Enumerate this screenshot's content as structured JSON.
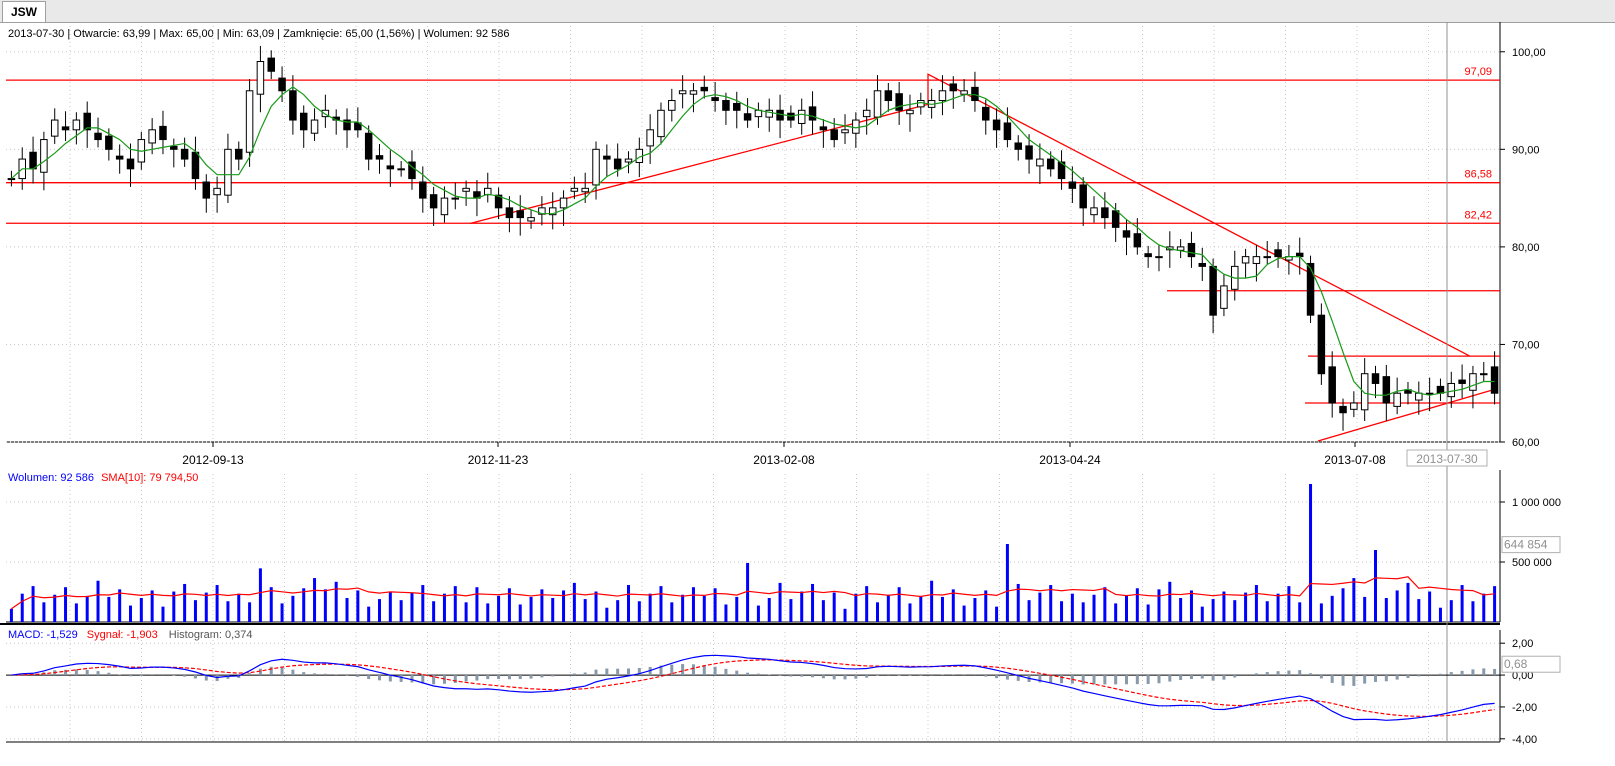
{
  "tab": {
    "label": "JSW"
  },
  "info_bar": {
    "date": "2013-07-30",
    "open": "Otwarcie: 63,99",
    "max": "Max: 65,00",
    "min": "Min: 63,09",
    "close": "Zamknięcie: 65,00 (1,56%)",
    "volume": "Wolumen: 92 586"
  },
  "volume_legend": {
    "volume": "Wolumen: 92 586",
    "sma": "SMA[10]: 79 794,50"
  },
  "macd_legend": {
    "macd": "MACD: -1,529",
    "signal": "Sygnał: -1,903",
    "histogram": "Histogram: 0,374"
  },
  "cursor": {
    "date_label": "2013-07-30",
    "volume_label": "644 854",
    "macd_label": "0,68"
  },
  "colors": {
    "candle": "#000000",
    "ma_line": "#1a9a1a",
    "levels": "#ff0000",
    "volume_bar": "#0000ff",
    "sma_line": "#ff0000",
    "macd_line": "#0000ff",
    "signal_line": "#ff0000",
    "histogram": "#8899aa"
  },
  "chart_data": [
    {
      "type": "candlestick",
      "title": "JSW",
      "x_ticks": [
        "2012-09-13",
        "2012-11-23",
        "2013-02-08",
        "2013-04-24",
        "2013-07-08"
      ],
      "y_ticks": [
        "60,00",
        "70,00",
        "80,00",
        "90,00",
        "100,00"
      ],
      "ylim": [
        60,
        101
      ],
      "horizontal_levels": [
        {
          "value": 97.09,
          "label": "97,09"
        },
        {
          "value": 86.58,
          "label": "86,58"
        },
        {
          "value": 82.42,
          "label": "82,42"
        }
      ],
      "close_approx": [
        87,
        89,
        88,
        91,
        93,
        92,
        93,
        92,
        91,
        90,
        89,
        88,
        91,
        92,
        91,
        90,
        89,
        87,
        85,
        86,
        90,
        89,
        96,
        99,
        98,
        96,
        93,
        92,
        93,
        94,
        93,
        92,
        92,
        89,
        89,
        88,
        88,
        87,
        85,
        84,
        85,
        85,
        86,
        85,
        86,
        84,
        83,
        83,
        83,
        84,
        84,
        85,
        86,
        86,
        90,
        89,
        88,
        89,
        90,
        92,
        94,
        95,
        96,
        96,
        96,
        95,
        94,
        94,
        93,
        94,
        94,
        93,
        93,
        94,
        93,
        92,
        91,
        92,
        93,
        94,
        96,
        95,
        94,
        94,
        95,
        95,
        96,
        96,
        96,
        95,
        93,
        92,
        91,
        90,
        89,
        89,
        88,
        87,
        86,
        84,
        84,
        83,
        82,
        81,
        80,
        79,
        79,
        80,
        80,
        79,
        78,
        73,
        76,
        78,
        79,
        79,
        79,
        79,
        79,
        79,
        73,
        67,
        64,
        63,
        64,
        67,
        66,
        64,
        65,
        65,
        65,
        65,
        65,
        66,
        66,
        67,
        67,
        65
      ]
    },
    {
      "type": "bar",
      "title": "Wolumen",
      "y_ticks": [
        "500 000",
        "1 000 000"
      ],
      "max_volume": 1150000,
      "series": [
        {
          "name": "Wolumen"
        },
        {
          "name": "SMA[10]"
        }
      ]
    },
    {
      "type": "line",
      "title": "MACD",
      "y_ticks": [
        "2,00",
        "0,00",
        "-2,00",
        "-4,00"
      ],
      "ylim": [
        -4.2,
        2.2
      ],
      "series": [
        {
          "name": "MACD"
        },
        {
          "name": "Sygnał"
        },
        {
          "name": "Histogram"
        }
      ]
    }
  ]
}
